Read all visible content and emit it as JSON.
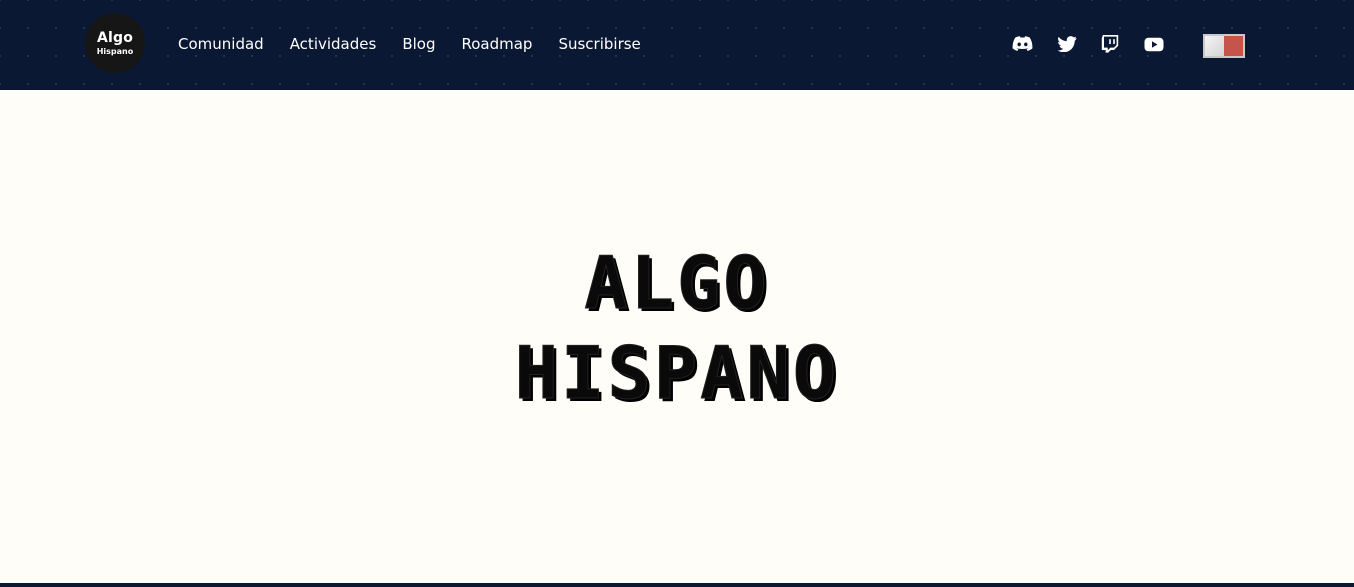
{
  "brand": {
    "line1": "Algo",
    "line2": "Hispano"
  },
  "nav": {
    "links": [
      {
        "label": "Comunidad"
      },
      {
        "label": "Actividades"
      },
      {
        "label": "Blog"
      },
      {
        "label": "Roadmap"
      },
      {
        "label": "Suscribirse"
      }
    ]
  },
  "social": {
    "icons": [
      "discord-icon",
      "twitter-icon",
      "twitch-icon",
      "youtube-icon"
    ]
  },
  "theme_toggle": {
    "accent_color": "#c4544c"
  },
  "hero": {
    "title_line1": "ALGO",
    "title_line2": "HISPANO"
  },
  "colors": {
    "navbar_bg": "#0b1833",
    "page_bg": "#fffdf8",
    "title": "#0a0a0a"
  }
}
